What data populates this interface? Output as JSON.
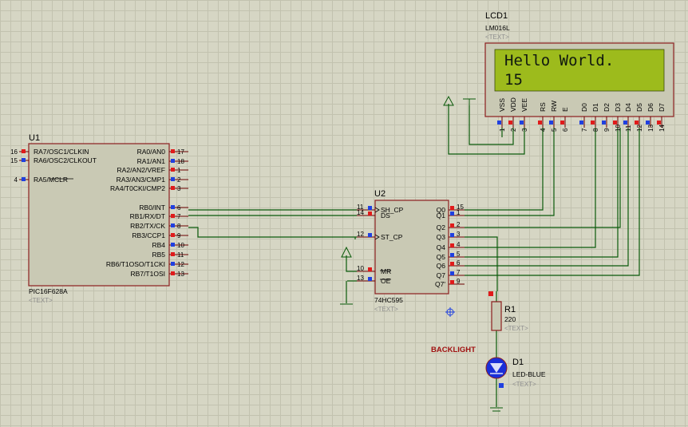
{
  "u1": {
    "ref": "U1",
    "part": "PIC16F628A",
    "text_placeholder": "<TEXT>",
    "left_pins": [
      {
        "num": "16",
        "label": "RA7/OSC1/CLKIN"
      },
      {
        "num": "15",
        "label": "RA6/OSC2/CLKOUT"
      },
      {
        "num": "4",
        "label": "RA5/MCLR"
      }
    ],
    "right_pins": [
      {
        "num": "17",
        "label": "RA0/AN0"
      },
      {
        "num": "18",
        "label": "RA1/AN1"
      },
      {
        "num": "1",
        "label": "RA2/AN2/VREF"
      },
      {
        "num": "2",
        "label": "RA3/AN3/CMP1"
      },
      {
        "num": "3",
        "label": "RA4/T0CKI/CMP2"
      },
      {
        "num": "6",
        "label": "RB0/INT"
      },
      {
        "num": "7",
        "label": "RB1/RX/DT"
      },
      {
        "num": "8",
        "label": "RB2/TX/CK"
      },
      {
        "num": "9",
        "label": "RB3/CCP1"
      },
      {
        "num": "10",
        "label": "RB4"
      },
      {
        "num": "11",
        "label": "RB5"
      },
      {
        "num": "12",
        "label": "RB6/T1OSO/T1CKI"
      },
      {
        "num": "13",
        "label": "RB7/T1OSI"
      }
    ]
  },
  "u2": {
    "ref": "U2",
    "part": "74HC595",
    "text_placeholder": "<TEXT>",
    "left_pins": [
      {
        "num": "11",
        "label": "SH_CP"
      },
      {
        "num": "14",
        "label": "DS"
      },
      {
        "num": "12",
        "label": "ST_CP"
      },
      {
        "num": "10",
        "label": "MR"
      },
      {
        "num": "13",
        "label": "OE"
      }
    ],
    "right_pins": [
      {
        "num": "15",
        "label": "Q0"
      },
      {
        "num": "1",
        "label": "Q1"
      },
      {
        "num": "2",
        "label": "Q2"
      },
      {
        "num": "3",
        "label": "Q3"
      },
      {
        "num": "4",
        "label": "Q4"
      },
      {
        "num": "5",
        "label": "Q5"
      },
      {
        "num": "6",
        "label": "Q6"
      },
      {
        "num": "7",
        "label": "Q7"
      },
      {
        "num": "9",
        "label": "Q7'"
      }
    ]
  },
  "lcd": {
    "ref": "LCD1",
    "part": "LM016L",
    "text_placeholder": "<TEXT>",
    "line1": "Hello World.",
    "line2": "15",
    "screen_color": "#9dbb1c",
    "pins": [
      {
        "num": "1",
        "label": "VSS"
      },
      {
        "num": "2",
        "label": "VDD"
      },
      {
        "num": "3",
        "label": "VEE"
      },
      {
        "num": "4",
        "label": "RS"
      },
      {
        "num": "5",
        "label": "RW"
      },
      {
        "num": "6",
        "label": "E"
      },
      {
        "num": "7",
        "label": "D0"
      },
      {
        "num": "8",
        "label": "D1"
      },
      {
        "num": "9",
        "label": "D2"
      },
      {
        "num": "10",
        "label": "D3"
      },
      {
        "num": "11",
        "label": "D4"
      },
      {
        "num": "12",
        "label": "D5"
      },
      {
        "num": "13",
        "label": "D6"
      },
      {
        "num": "14",
        "label": "D7"
      }
    ]
  },
  "r1": {
    "ref": "R1",
    "value": "220",
    "text_placeholder": "<TEXT>"
  },
  "d1": {
    "ref": "D1",
    "part": "LED-BLUE",
    "text_placeholder": "<TEXT>",
    "color": "#1a2fd8"
  },
  "net_label": "BACKLIGHT"
}
